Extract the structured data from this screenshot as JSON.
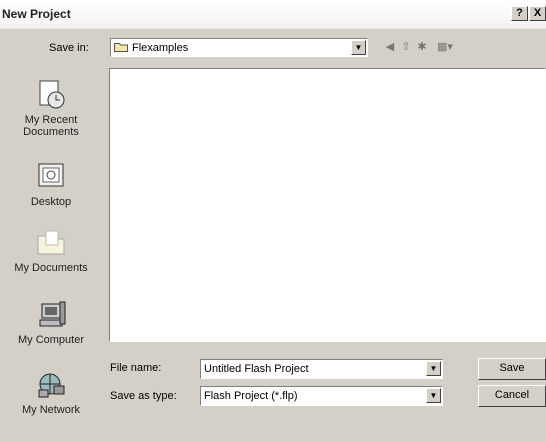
{
  "window": {
    "title": "New Project",
    "help_label": "?",
    "close_label": "X"
  },
  "toolbar": {
    "save_in_label": "Save in:",
    "folder_name": "Flexamples",
    "back_icon": "back-arrow-icon",
    "up_icon": "up-folder-icon",
    "new_folder_icon": "new-folder-icon",
    "views_icon": "views-menu-icon"
  },
  "places": [
    {
      "label": "My Recent Documents",
      "icon": "recent-documents-icon"
    },
    {
      "label": "Desktop",
      "icon": "desktop-icon"
    },
    {
      "label": "My Documents",
      "icon": "my-documents-icon"
    },
    {
      "label": "My Computer",
      "icon": "my-computer-icon"
    },
    {
      "label": "My Network",
      "icon": "my-network-icon"
    }
  ],
  "file_list": {
    "items": []
  },
  "form": {
    "file_name_label": "File name:",
    "file_name_value": "Untitled Flash Project",
    "file_type_label": "Save as type:",
    "file_type_value": "Flash Project (*.flp)"
  },
  "buttons": {
    "save": "Save",
    "cancel": "Cancel"
  }
}
